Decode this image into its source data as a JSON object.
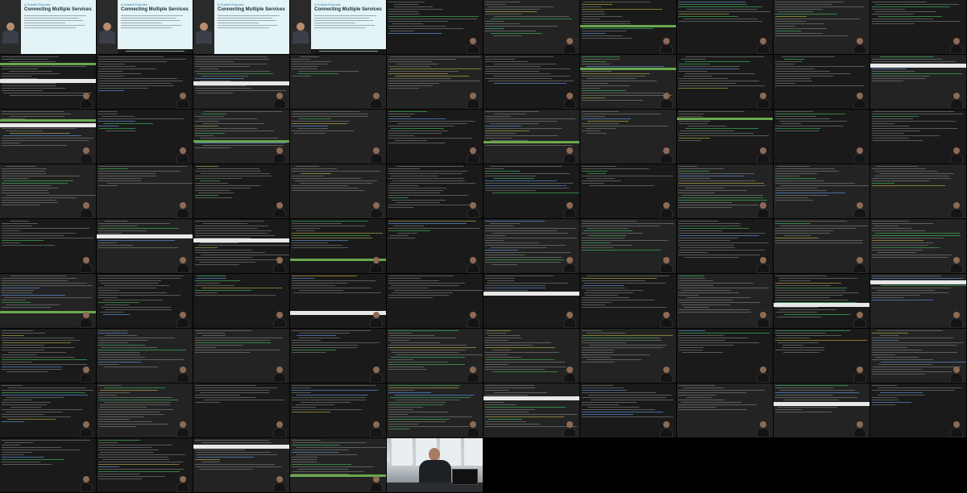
{
  "video": {
    "thumbnail_count": 85
  },
  "slides": [
    {
      "kicker": "# Guided Exercise",
      "title": "Connecting Multiple Services"
    },
    {
      "kicker": "# Guided Exercise",
      "title": "Connecting Multiple Services"
    },
    {
      "kicker": "# Guided Exercise",
      "title": "Connecting Multiple Services"
    },
    {
      "kicker": "# Guided Exercise",
      "title": "Connecting Multiple Services"
    }
  ]
}
